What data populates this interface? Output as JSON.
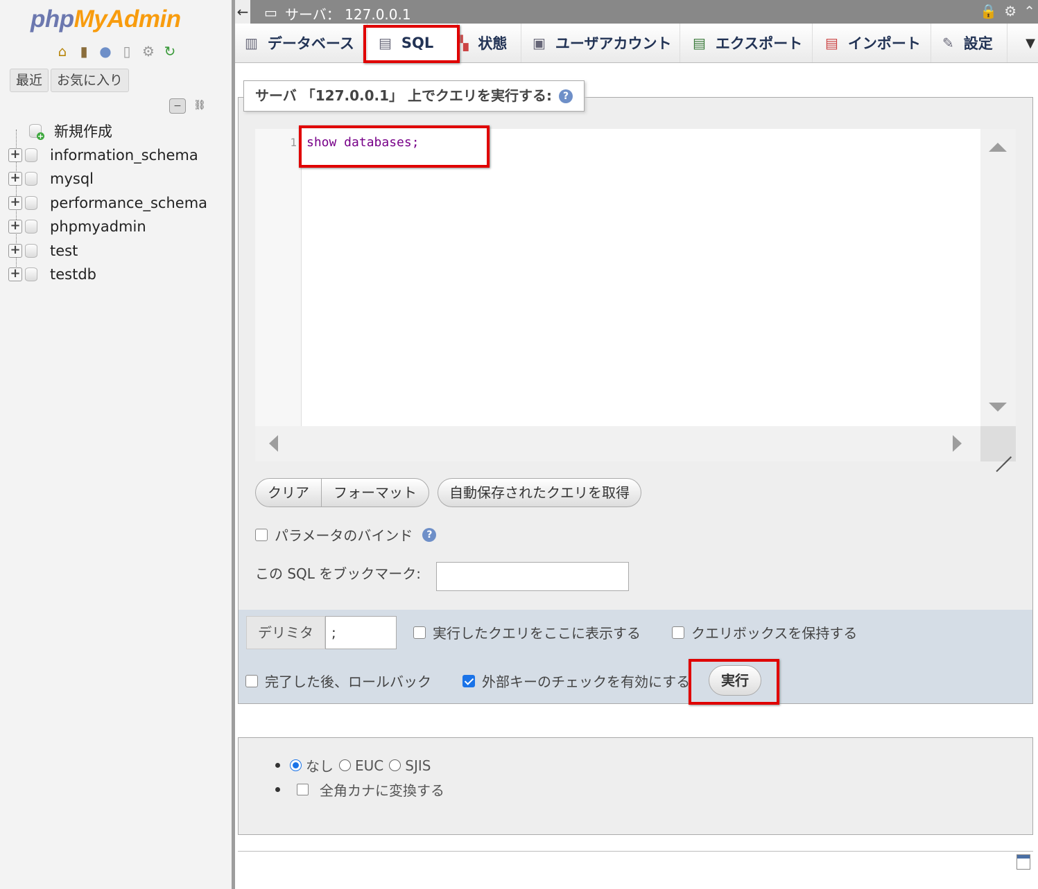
{
  "nav": {
    "logo": {
      "part1": "php",
      "part2": "MyAdmin"
    },
    "icons": [
      "home-icon",
      "exit-icon",
      "help-icon",
      "docs-icon",
      "settings-icon",
      "reload-icon"
    ],
    "tabs": {
      "recent": "最近",
      "favorites": "お気に入り"
    },
    "tree": {
      "new": "新規作成",
      "databases": [
        "information_schema",
        "mysql",
        "performance_schema",
        "phpmyadmin",
        "test",
        "testdb"
      ]
    }
  },
  "serverbar": {
    "title": "サーバ： 127.0.0.1"
  },
  "menu": {
    "tabs": [
      {
        "label": "データベース",
        "icon": "database-icon"
      },
      {
        "label": "SQL",
        "icon": "sql-icon",
        "active": true
      },
      {
        "label": "状態",
        "icon": "status-icon"
      },
      {
        "label": "ユーザアカウント",
        "icon": "users-icon"
      },
      {
        "label": "エクスポート",
        "icon": "export-icon"
      },
      {
        "label": "インポート",
        "icon": "import-icon"
      },
      {
        "label": "設定",
        "icon": "settings-icon"
      }
    ]
  },
  "query": {
    "legend": "サーバ 「127.0.0.1」 上でクエリを実行する:",
    "line_number": "1",
    "code": "show databases;",
    "buttons": {
      "clear": "クリア",
      "format": "フォーマット",
      "autosave": "自動保存されたクエリを取得"
    },
    "bind_params": "パラメータのバインド",
    "bookmark_label": "この SQL をブックマーク:",
    "bookmark_value": ""
  },
  "options": {
    "delimiter_label": "デリミタ",
    "delimiter_value": ";",
    "show_query": "実行したクエリをここに表示する",
    "retain_box": "クエリボックスを保持する",
    "rollback": "完了した後、ロールバック",
    "fk_check": "外部キーのチェックを有効にする",
    "fk_checked": true,
    "go": "実行"
  },
  "encoding": {
    "none": "なし",
    "euc": "EUC",
    "sjis": "SJIS",
    "selected": "なし",
    "kana": "全角カナに変換する"
  },
  "highlight_color": "#e00000"
}
